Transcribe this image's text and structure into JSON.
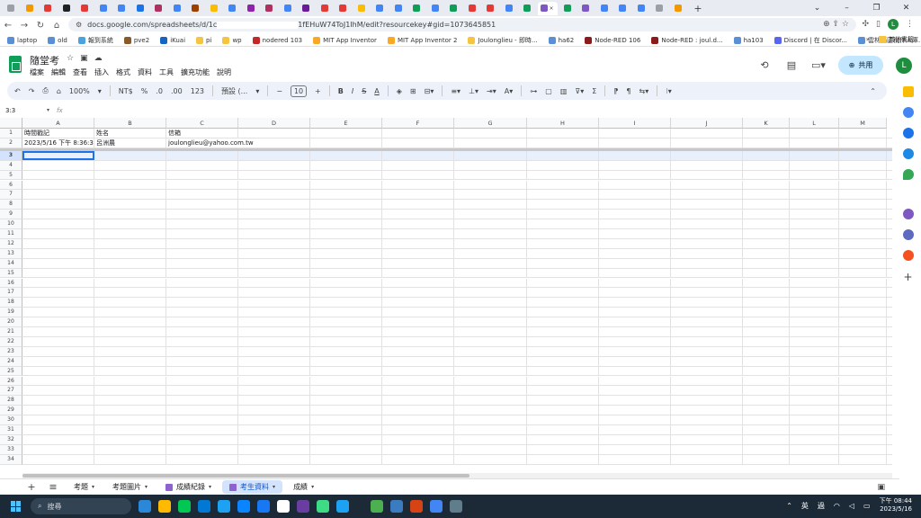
{
  "browser": {
    "tab_count": 41,
    "active_tab_label": "×",
    "new_tab": "+",
    "window_controls": [
      "⌄",
      "–",
      "❐",
      "✕"
    ],
    "url_prefix": "docs.google.com/spreadsheets/d/1c",
    "url_suffix": "1fEHuW74ToJ1IhM/edit?resourcekey#gid=1073645851",
    "profile_initial": "L"
  },
  "bookmarks": {
    "items": [
      "laptop",
      "old",
      "報到系統",
      "pve2",
      "iKuai",
      "pi",
      "wp",
      "nodered 103",
      "MIT App Inventor",
      "MIT App Inventor 2",
      "Joulonglieu - 即時...",
      "ha62",
      "Node-RED 106",
      "Node-RED : joul.d...",
      "ha103",
      "Discord | 在 Discor...",
      "雲林縣區稅作人庫..."
    ],
    "overflow": "»",
    "other": "其他書籤"
  },
  "doc": {
    "title": "隨堂考",
    "menu": [
      "檔案",
      "編輯",
      "查看",
      "插入",
      "格式",
      "資料",
      "工具",
      "擴充功能",
      "說明"
    ],
    "share_label": "共用",
    "user_initial": "L"
  },
  "toolbar": {
    "zoom": "100%",
    "currency": "NT$",
    "percent": "%",
    "dec_less": ".0",
    "dec_more": ".00",
    "number_format": "123",
    "font": "預設 (...",
    "font_size": "10",
    "bold": "B",
    "italic": "I",
    "strike": "S",
    "text_color": "A"
  },
  "formula_bar": {
    "name_box": "3:3",
    "fx": "fx",
    "value": ""
  },
  "sheet": {
    "columns": [
      "A",
      "B",
      "C",
      "D",
      "E",
      "F",
      "G",
      "H",
      "I",
      "J",
      "K",
      "L",
      "M"
    ],
    "selected_column": "",
    "row_count": 34,
    "selected_row": 3,
    "cells": {
      "r1": [
        "時間戳記",
        "姓名",
        "信箱"
      ],
      "r2": [
        "2023/5/16 下午 8:36:38",
        "呂洲農",
        "joulonglieu@yahoo.com.tw"
      ]
    }
  },
  "sheet_tabs": {
    "items": [
      "考題",
      "考題圖片",
      "成績紀錄",
      "考生資料",
      "成績"
    ],
    "active": "考生資料"
  },
  "taskbar": {
    "search_placeholder": "搜尋",
    "ime_lang": "英",
    "ime_mode": "過",
    "time": "下午 08:44",
    "date": "2023/5/16"
  },
  "colors": {
    "sheets_green": "#0f9d58",
    "selection_blue": "#1a73e8",
    "share_bg": "#c2e7ff",
    "taskbar_bg": "#1c2a38"
  }
}
